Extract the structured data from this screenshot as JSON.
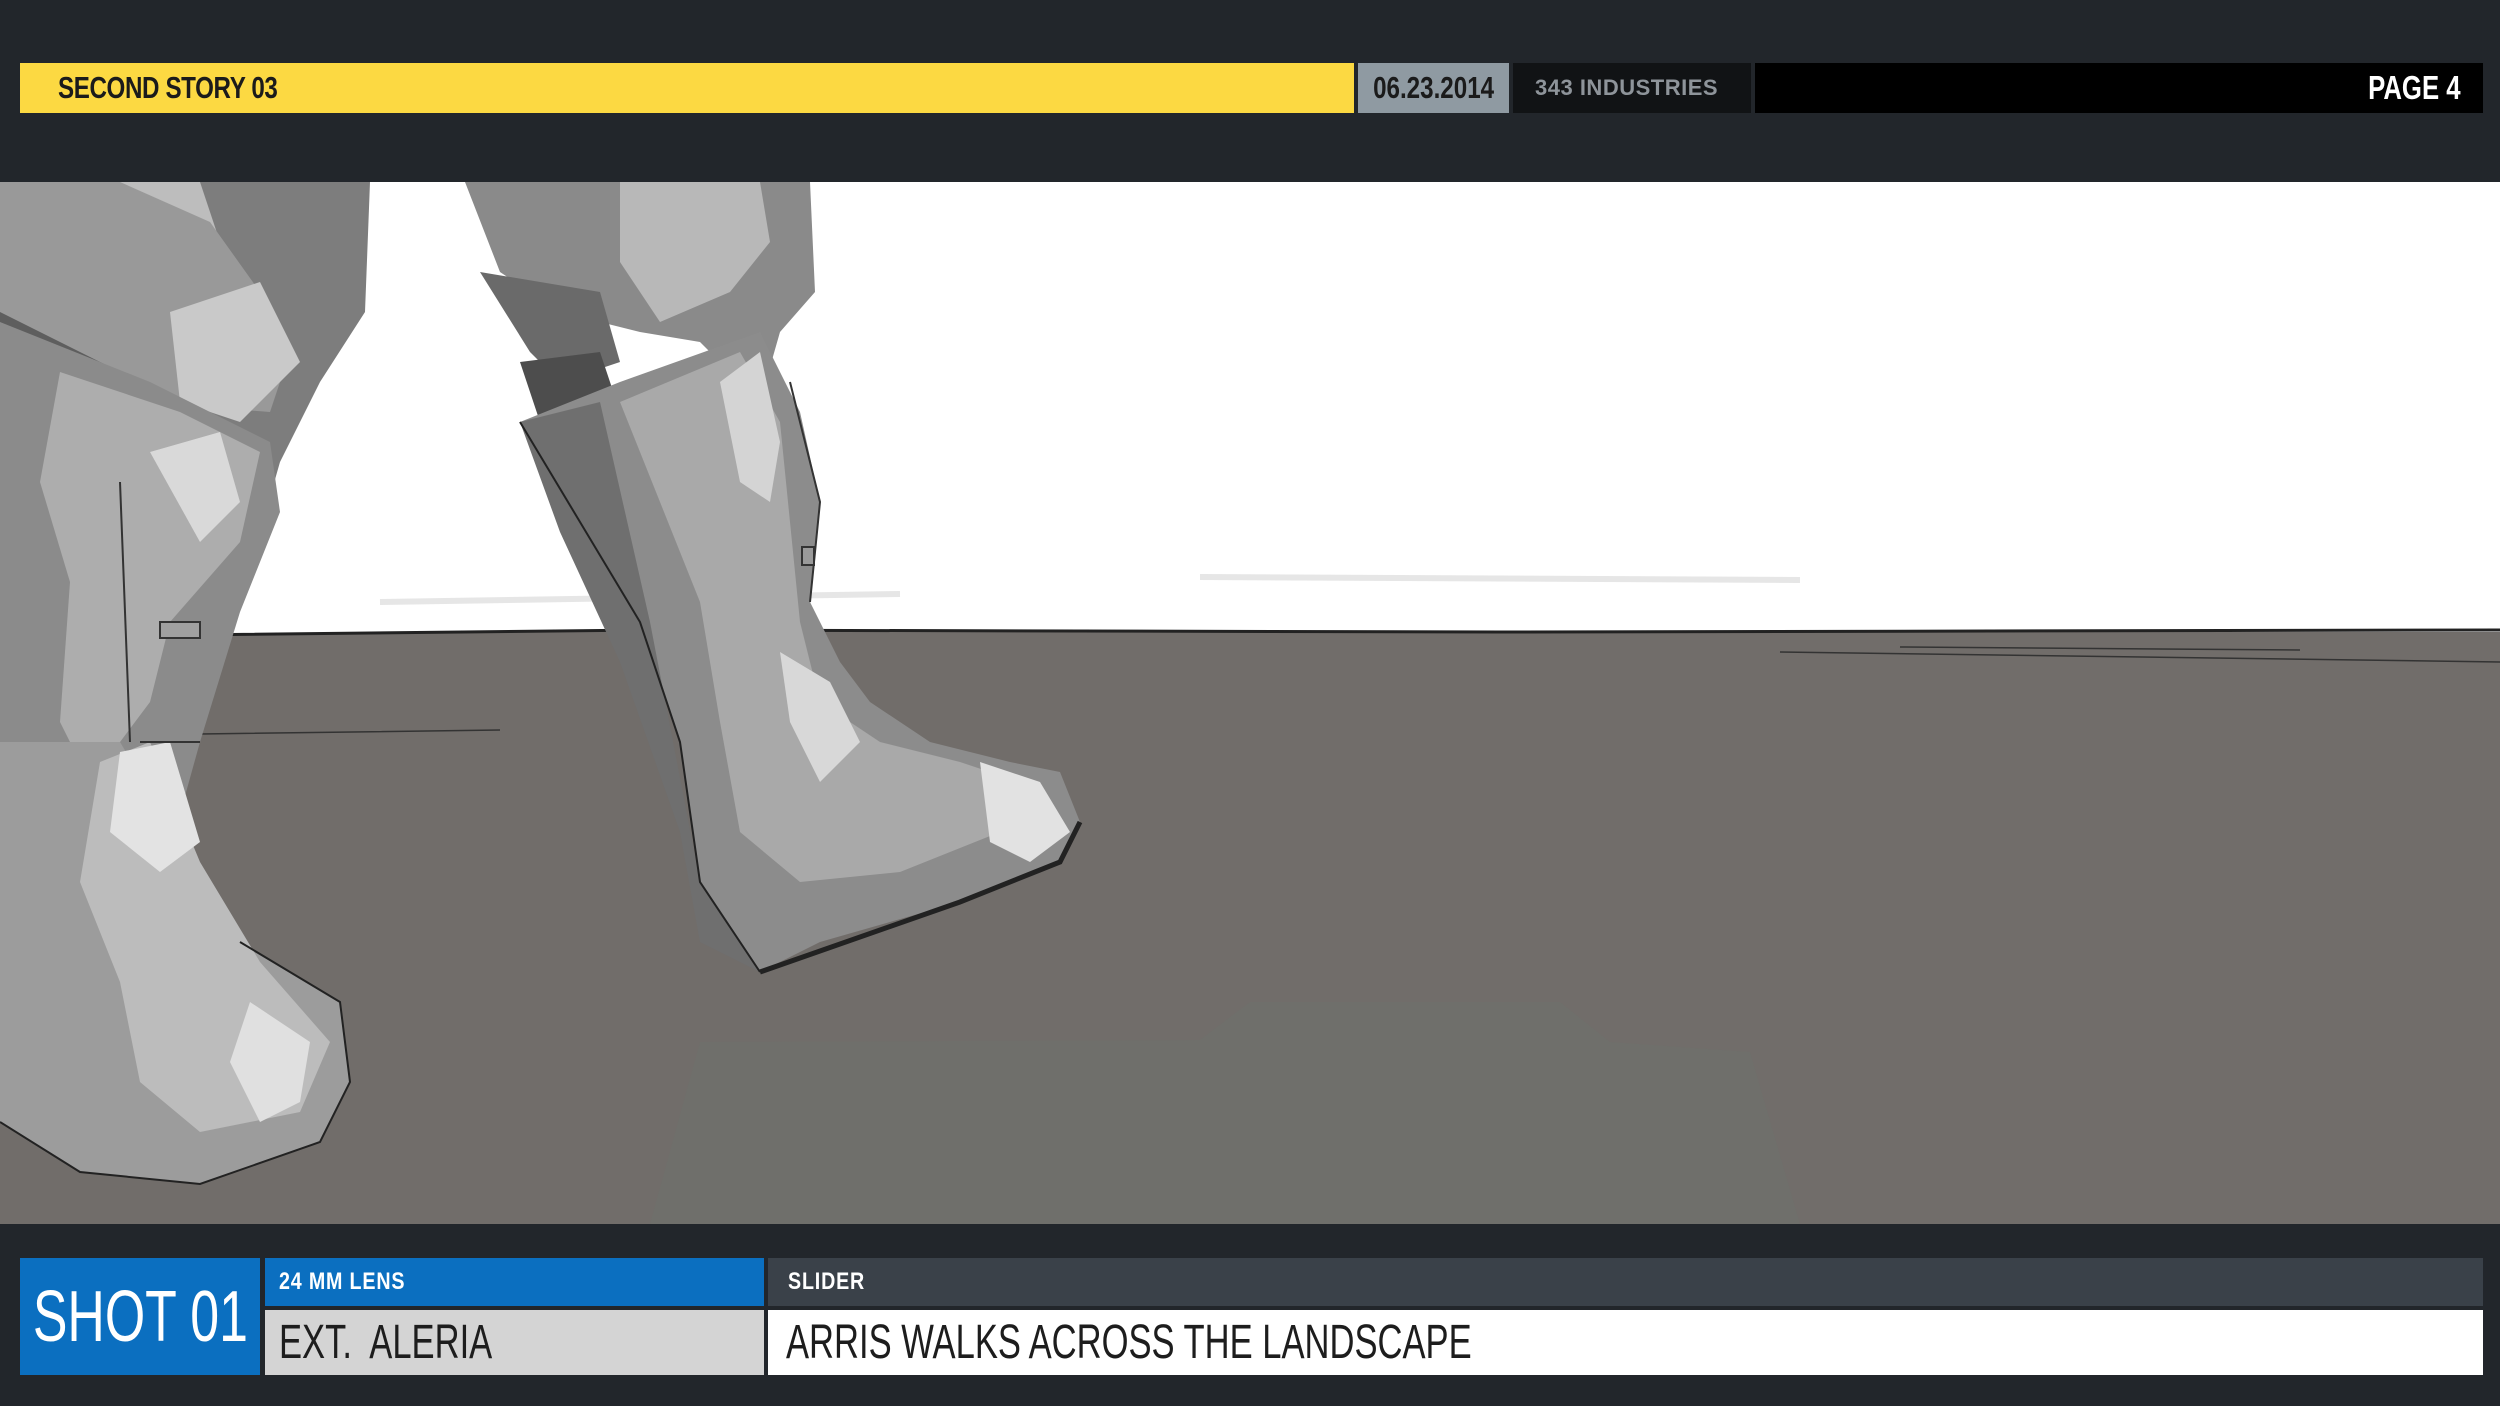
{
  "header": {
    "title": "SECOND STORY 03",
    "date": "06.23.2014",
    "studio": "343 INDUSTRIES",
    "page": "PAGE  4",
    "accent_color": "#fcd942"
  },
  "panel": {
    "scene": "Armored legs and boots walking across a flat grey landscape"
  },
  "footer": {
    "shot": "SHOT 01",
    "lens": "24 MM LENS",
    "camera_move": "SLIDER",
    "location": "EXT.  ALERIA",
    "action": "ARRIS WALKS ACROSS THE LANDSCAPE",
    "shot_color": "#0b6fc0"
  }
}
